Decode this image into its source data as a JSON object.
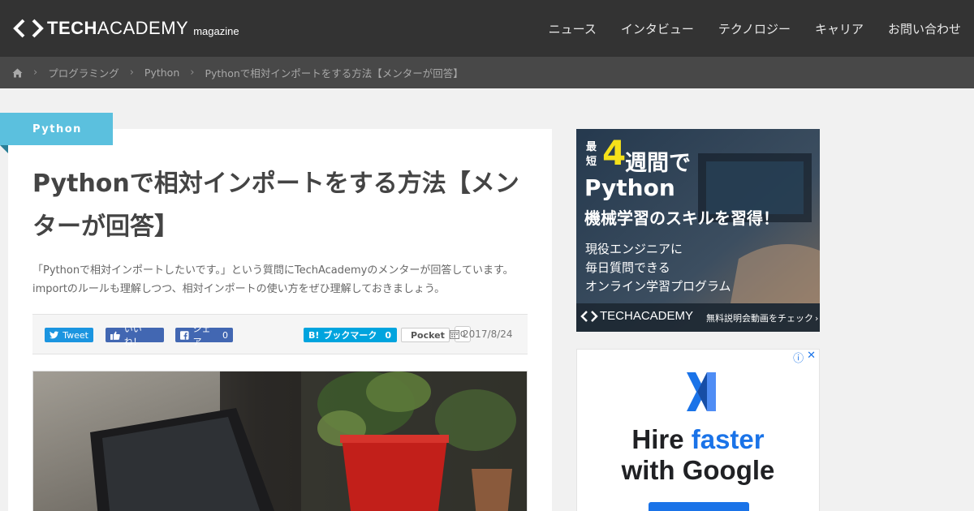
{
  "header": {
    "logo_bold": "TECH",
    "logo_thin": "ACADEMY",
    "logo_sub": "magazine",
    "nav": [
      "ニュース",
      "インタビュー",
      "テクノロジー",
      "キャリア",
      "お問い合わせ"
    ]
  },
  "breadcrumb": {
    "items": [
      "プログラミング",
      "Python",
      "Pythonで相対インポートをする方法【メンターが回答】"
    ]
  },
  "article": {
    "category": "Python",
    "title": "Pythonで相対インポートをする方法【メンターが回答】",
    "lead_line1": "「Pythonで相対インポートしたいです。」という質問にTechAcademyのメンターが回答しています。",
    "lead_line2": "importのルールも理解しつつ、相対インポートの使い方をぜひ理解しておきましょう。",
    "date": "2017/8/24",
    "share": {
      "tweet": "Tweet",
      "like": "いいね！",
      "fb_share": "シェア",
      "fb_share_count": "0",
      "hatena": "ブックマーク",
      "hatena_mark": "B!",
      "hatena_count": "0",
      "pocket": "Pocket",
      "pocket_count": "0"
    }
  },
  "ad_techacademy": {
    "line1_small_a": "最",
    "line1_small_b": "短",
    "line1_num": "4",
    "line1_rest": "週間で",
    "line2": "Python",
    "line3": "機械学習のスキルを習得！",
    "sub1": "現役エンジニアに",
    "sub2": "毎日質問できる",
    "sub3": "オンライン学習プログラム",
    "footer_logo": "TECHACADEMY",
    "footer_cta": "無料説明会動画をチェック"
  },
  "ad_google": {
    "line1_a": "Hire ",
    "line1_b": "faster",
    "line2": "with Google"
  },
  "colors": {
    "header_bg": "#333333",
    "breadcrumb_bg": "#484848",
    "category": "#5bc0de",
    "google_blue": "#1a73e8"
  }
}
